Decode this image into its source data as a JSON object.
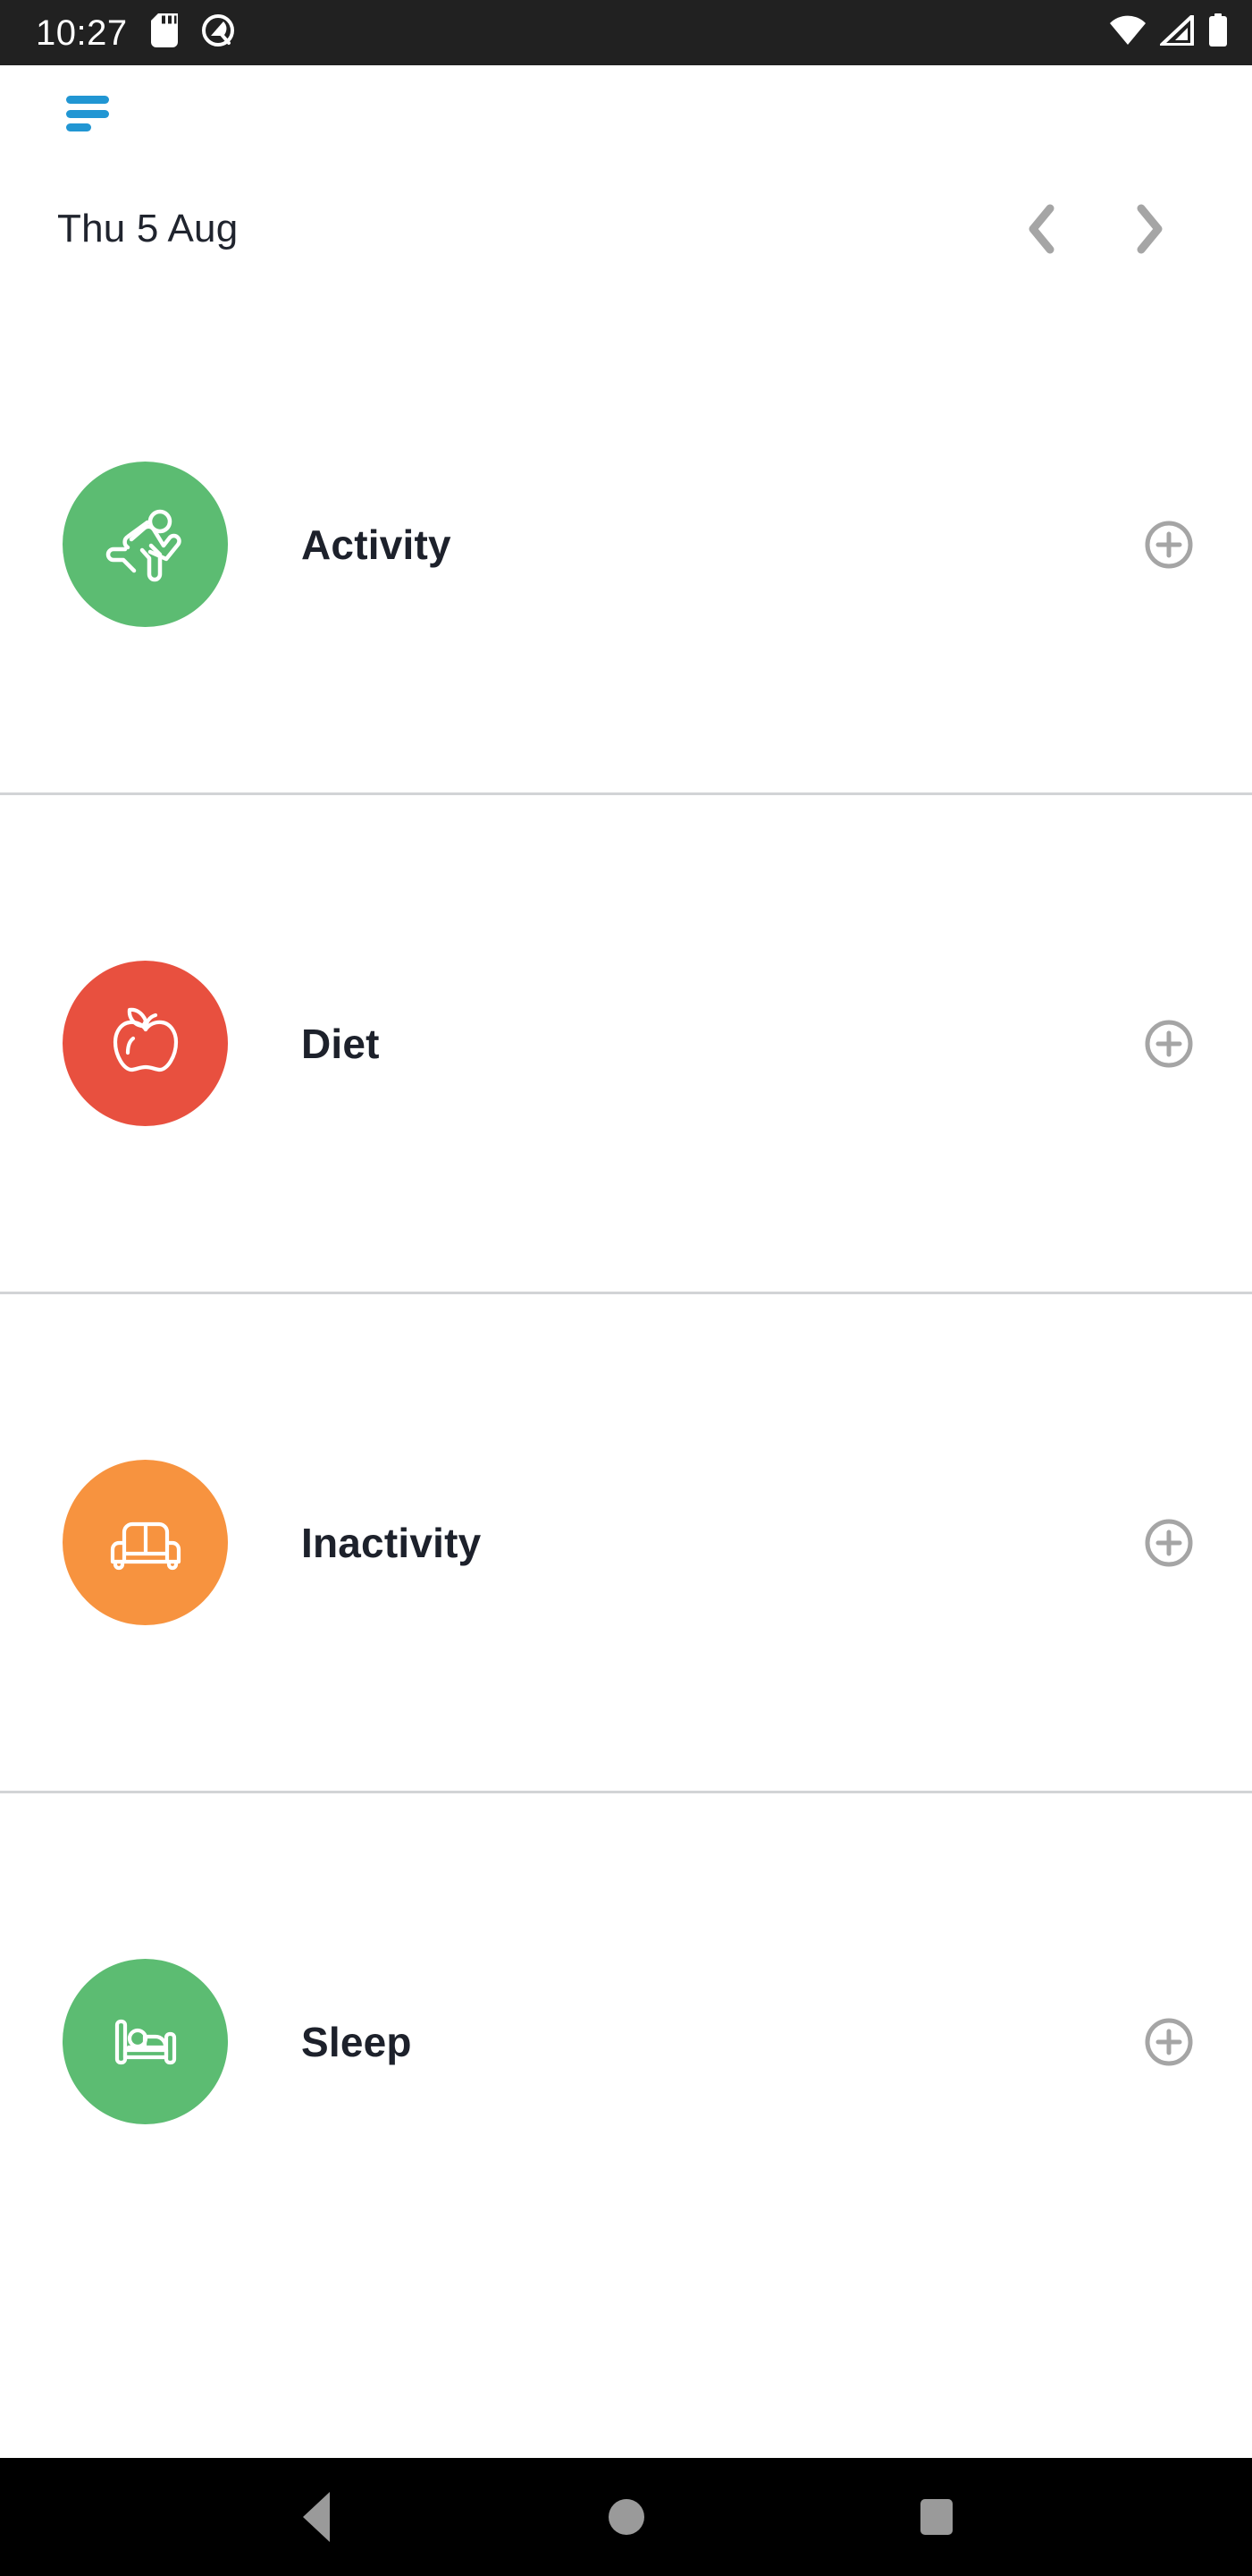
{
  "status_bar": {
    "clock": "10:27",
    "left_icons": [
      "sd-card-icon",
      "android-q-icon"
    ],
    "right_icons": [
      "wifi-icon",
      "cellular-signal-icon",
      "battery-full-icon"
    ],
    "background_color": "#212121"
  },
  "top_bar": {
    "menu_icon": "hamburger-menu-icon",
    "menu_color": "#2196d3"
  },
  "date_nav": {
    "date": "Thu 5 Aug",
    "prev_icon": "chevron-left-icon",
    "next_icon": "chevron-right-icon",
    "arrow_color": "#a5a5a5"
  },
  "list": {
    "rows": [
      {
        "label": "Activity",
        "icon": "running-person-icon",
        "badge_color": "#5cbc72",
        "add_icon": "plus-circle-icon"
      },
      {
        "label": "Diet",
        "icon": "apple-icon",
        "badge_color": "#e8503f",
        "add_icon": "plus-circle-icon"
      },
      {
        "label": "Inactivity",
        "icon": "sofa-icon",
        "badge_color": "#f7933f",
        "add_icon": "plus-circle-icon"
      },
      {
        "label": "Sleep",
        "icon": "bed-icon",
        "badge_color": "#5cbc72",
        "add_icon": "plus-circle-icon"
      }
    ],
    "divider_color": "#d2d4d6"
  },
  "nav_bar": {
    "back_label": "back-button",
    "home_label": "home-button",
    "recents_label": "recents-button",
    "icon_color": "#9a9a9a",
    "background_color": "#000000"
  }
}
